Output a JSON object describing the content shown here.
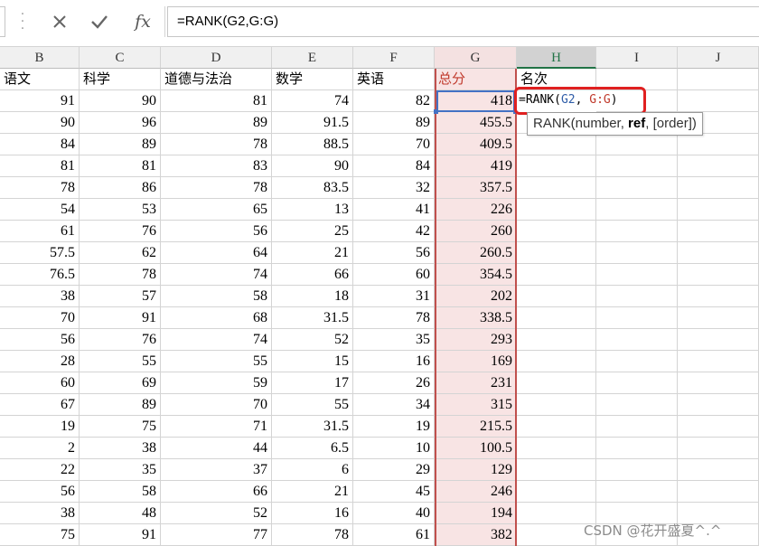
{
  "formula_bar": {
    "cancel_icon": "cancel-x-icon",
    "enter_icon": "checkmark-icon",
    "fx_label": "fx",
    "formula": "=RANK(G2,G:G)"
  },
  "columns": [
    "B",
    "C",
    "D",
    "E",
    "F",
    "G",
    "H",
    "I",
    "J"
  ],
  "headers": [
    "语文",
    "科学",
    "道德与法治",
    "数学",
    "英语",
    "总分",
    "名次"
  ],
  "rows": [
    [
      "91",
      "90",
      "81",
      "74",
      "82",
      "418"
    ],
    [
      "90",
      "96",
      "89",
      "91.5",
      "89",
      "455.5"
    ],
    [
      "84",
      "89",
      "78",
      "88.5",
      "70",
      "409.5"
    ],
    [
      "81",
      "81",
      "83",
      "90",
      "84",
      "419"
    ],
    [
      "78",
      "86",
      "78",
      "83.5",
      "32",
      "357.5"
    ],
    [
      "54",
      "53",
      "65",
      "13",
      "41",
      "226"
    ],
    [
      "61",
      "76",
      "56",
      "25",
      "42",
      "260"
    ],
    [
      "57.5",
      "62",
      "64",
      "21",
      "56",
      "260.5"
    ],
    [
      "76.5",
      "78",
      "74",
      "66",
      "60",
      "354.5"
    ],
    [
      "38",
      "57",
      "58",
      "18",
      "31",
      "202"
    ],
    [
      "70",
      "91",
      "68",
      "31.5",
      "78",
      "338.5"
    ],
    [
      "56",
      "76",
      "74",
      "52",
      "35",
      "293"
    ],
    [
      "28",
      "55",
      "55",
      "15",
      "16",
      "169"
    ],
    [
      "60",
      "69",
      "59",
      "17",
      "26",
      "231"
    ],
    [
      "67",
      "89",
      "70",
      "55",
      "34",
      "315"
    ],
    [
      "19",
      "75",
      "71",
      "31.5",
      "19",
      "215.5"
    ],
    [
      "2",
      "38",
      "44",
      "6.5",
      "10",
      "100.5"
    ],
    [
      "22",
      "35",
      "37",
      "6",
      "29",
      "129"
    ],
    [
      "56",
      "58",
      "66",
      "21",
      "45",
      "246"
    ],
    [
      "38",
      "48",
      "52",
      "16",
      "40",
      "194"
    ],
    [
      "75",
      "91",
      "77",
      "78",
      "61",
      "382"
    ]
  ],
  "active_cell": {
    "prefix": "=RANK(",
    "arg1": "G2",
    "comma": ", ",
    "arg2": "G:G",
    "suffix": ")"
  },
  "tooltip": {
    "func": "RANK(number, ",
    "bold": "ref",
    "rest": ", [order])"
  },
  "watermark": "CSDN @花开盛夏^.^",
  "colors": {
    "highlight_red": "#e02020",
    "range_blue": "#4472c4",
    "column_g_fill": "#f8e4e4"
  }
}
